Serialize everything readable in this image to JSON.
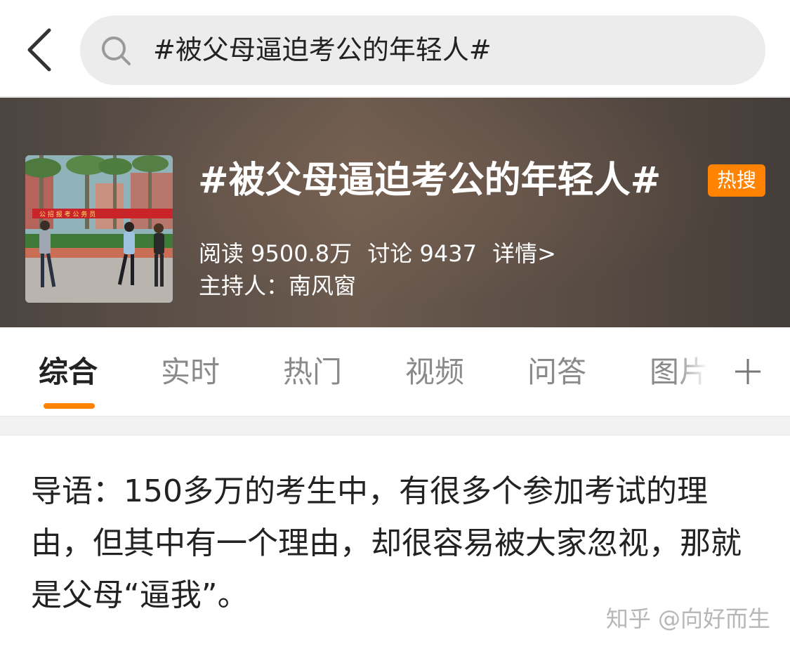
{
  "search": {
    "query": "#被父母逼迫考公的年轻人#"
  },
  "topic": {
    "title": "#被父母逼迫考公的年轻人#",
    "badge": "热搜",
    "reads": "阅读 9500.8万",
    "discussions": "讨论 9437",
    "details": "详情>",
    "host": "主持人：南风窗",
    "cover_banner": "公 招 报 考 公 务 员"
  },
  "tabs": {
    "items": [
      {
        "label": "综合",
        "active": true
      },
      {
        "label": "实时"
      },
      {
        "label": "热门"
      },
      {
        "label": "视频"
      },
      {
        "label": "问答"
      },
      {
        "label": "图片"
      }
    ]
  },
  "intro": {
    "text": "导语：150多万的考生中，有很多个参加考试的理由，但其中有一个理由，却很容易被大家忽视，那就是父母“逼我”。"
  },
  "watermark": "知乎 @向好而生",
  "colors": {
    "accent": "#ff8200",
    "header_bg": "#5a4d45"
  },
  "icons": [
    "back-arrow-icon",
    "search-icon",
    "plus-icon"
  ]
}
